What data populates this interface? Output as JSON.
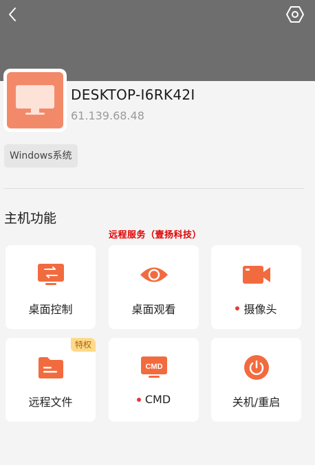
{
  "host": {
    "name": "DESKTOP-I6RK42I",
    "ip": "61.139.68.48",
    "os_tag": "Windows系统"
  },
  "section_title": "主机功能",
  "watermark": "远程服务（壹扬科技）",
  "functions": [
    {
      "label": "桌面控制",
      "icon": "desktop-control-icon",
      "status_dot": false
    },
    {
      "label": "桌面观看",
      "icon": "eye-icon",
      "status_dot": false
    },
    {
      "label": "摄像头",
      "icon": "video-camera-icon",
      "status_dot": true
    },
    {
      "label": "远程文件",
      "icon": "folder-icon",
      "status_dot": false,
      "badge": "特权"
    },
    {
      "label": "CMD",
      "icon": "cmd-terminal-icon",
      "status_dot": true
    },
    {
      "label": "关机/重启",
      "icon": "power-icon",
      "status_dot": false
    }
  ],
  "colors": {
    "accent": "#f26b3f",
    "header_bg": "#6e6e6e",
    "status_dot": "#e53935",
    "badge_bg": "#ffd98a"
  }
}
